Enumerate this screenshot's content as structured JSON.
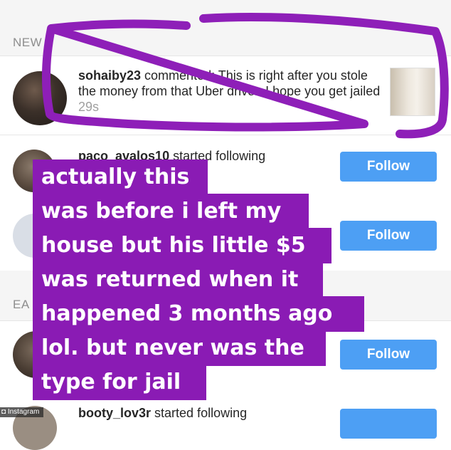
{
  "sections": {
    "new_label": "NEW",
    "earlier_label": "EA"
  },
  "notifications": [
    {
      "username": "sohaiby23",
      "action": " commented: This is right after you stole the money from that Uber driver. I hope you get jailed ",
      "time": "29s"
    },
    {
      "username": "paco_avalos10",
      "action": " started following",
      "button": "Follow"
    },
    {
      "button": "Follow"
    },
    {
      "button": "Follow"
    },
    {
      "username": "booty_lov3r",
      "action": " started following"
    }
  ],
  "caption_lines": [
    "actually this",
    " was before i left my",
    "house but his little $5",
    "was returned when it",
    "happened 3 months ago",
    "lol. but never was the",
    "type for jail"
  ],
  "watermark": "Instagram",
  "colors": {
    "overlay": "#8a1bb4",
    "follow_button": "#4d9ff4",
    "highlight_circle": "#8e1fb8"
  }
}
